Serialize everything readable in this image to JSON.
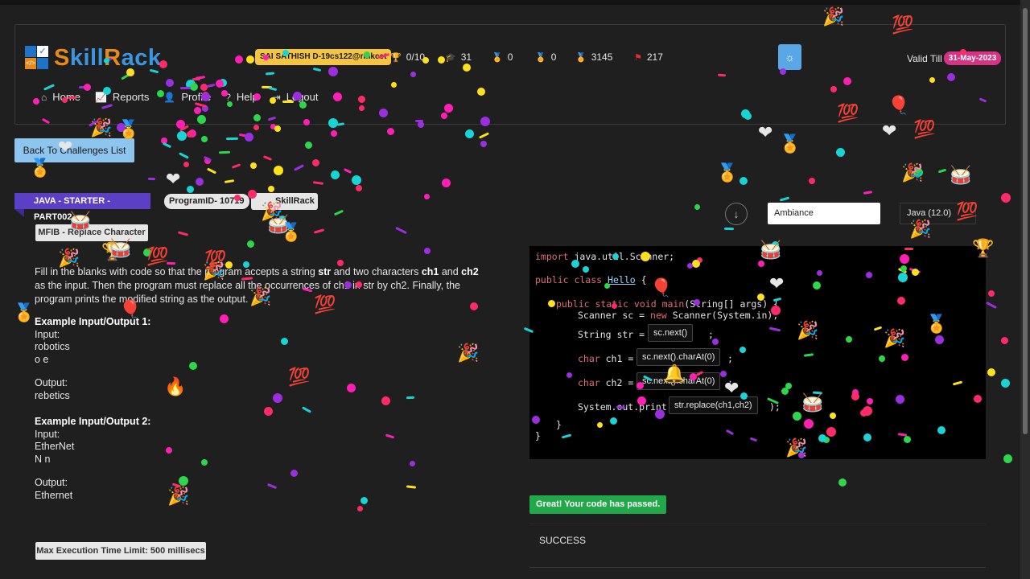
{
  "header": {
    "logo_text": "SkillRack",
    "user_badge": "SAI SATHISH D-19cs122@rmkcet",
    "stats": [
      {
        "icon": "trophy-icon",
        "value": "0/10"
      },
      {
        "icon": "graduation-cap-icon",
        "value": "31"
      },
      {
        "icon": "medal-gold-icon",
        "value": "0"
      },
      {
        "icon": "medal-silver-icon",
        "value": "0"
      },
      {
        "icon": "medal-red-icon",
        "value": "3145"
      },
      {
        "icon": "flag-icon",
        "value": "217"
      }
    ],
    "theme_toggle_icon": "sun-icon",
    "valid_label": "Valid Till",
    "valid_date": "31-May-2023",
    "nav": [
      {
        "icon": "home-icon",
        "label": "Home"
      },
      {
        "icon": "chart-icon",
        "label": "Reports"
      },
      {
        "icon": "user-icon",
        "label": "Profile"
      },
      {
        "icon": "question-icon",
        "label": "Help"
      },
      {
        "icon": "logout-icon",
        "label": "Logout"
      }
    ]
  },
  "challenge": {
    "back_label": "Back To Challenges List",
    "track": "JAVA - STARTER - PART002",
    "program_id": "ProgramID- 10719",
    "skillrack_tag": "SkillRack",
    "title": "MFIB - Replace Character",
    "description_parts": {
      "p1": "Fill in the blanks with code so that the program accepts a string ",
      "b1": "str",
      "p2": " and two characters ",
      "b2": "ch1",
      "p3": " and ",
      "b3": "ch2",
      "p4": " as the input. Then the program must replace all the occurrences of ch1 in str by ch2. Finally, the program prints the modified string as the output."
    },
    "examples": [
      {
        "heading": "Example Input/Output 1:",
        "input_label": "Input:",
        "input_lines": [
          "robotics",
          "o e"
        ],
        "output_label": "Output:",
        "output": "rebetics"
      },
      {
        "heading": "Example Input/Output 2:",
        "input_label": "Input:",
        "input_lines": [
          "EtherNet",
          "N n"
        ],
        "output_label": "Output:",
        "output": "Ethernet"
      }
    ],
    "time_limit": "Max Execution Time Limit: 500 millisecs"
  },
  "editor": {
    "theme_select": "Ambiance",
    "language_select": "Java (12.0)",
    "download_icon": "arrow-down-circle-icon",
    "code": {
      "l1_kw": "import",
      "l1_rest": " java.util.Scanner;",
      "l2_kw": "public class",
      "l2_cls": "Hello",
      "l2_rest": " {",
      "l3_kw": "public static void",
      "l3_fn": "main",
      "l3_rest": "(String[] args) {",
      "l4_a": "Scanner sc = ",
      "l4_kw": "new",
      "l4_b": " Scanner(System.in);",
      "l5_a": "String str = ",
      "l6_kw": "char",
      "l6_a": " ch1 = ",
      "l7_kw": "char",
      "l7_a": " ch2 = ",
      "l8_a": "System.out.print(",
      "l8_b": ");",
      "l9": "}",
      "l10": "}"
    },
    "blanks": [
      "sc.next()",
      "sc.next().charAt(0)",
      "sc.next().charAt(0)",
      "str.replace(ch1,ch2)"
    ],
    "semicolon": ";"
  },
  "result": {
    "passed_label": "Great! Your code has passed.",
    "status": "SUCCESS"
  },
  "colors": {
    "accent_blue": "#5aa7e6",
    "ribbon_purple": "#5b3fc4",
    "success_green": "#22a84a",
    "date_pink": "#d63384",
    "badge_yellow": "#f5c542"
  }
}
